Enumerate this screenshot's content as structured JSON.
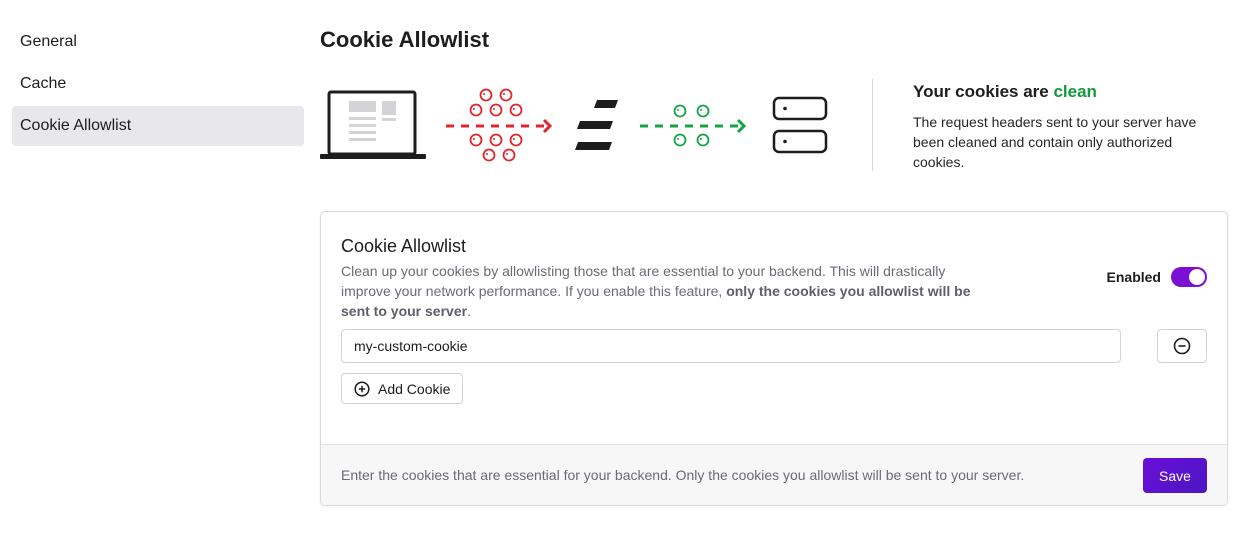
{
  "sidebar": {
    "items": [
      {
        "label": "General",
        "active": false
      },
      {
        "label": "Cache",
        "active": false
      },
      {
        "label": "Cookie Allowlist",
        "active": true
      }
    ]
  },
  "page": {
    "title": "Cookie Allowlist"
  },
  "status": {
    "title_prefix": "Your cookies are ",
    "title_highlight": "clean",
    "description": "The request headers sent to your server have been cleaned and contain only authorized cookies."
  },
  "card": {
    "title": "Cookie Allowlist",
    "description_plain": "Clean up your cookies by allowlisting those that are essential to your backend. This will drastically improve your network performance. If you enable this feature, ",
    "description_bold": "only the cookies you allowlist will be sent to your server",
    "description_end": ".",
    "enabled_label": "Enabled",
    "enabled": true,
    "cookie_value": "my-custom-cookie",
    "add_label": "Add Cookie",
    "footer_text": "Enter the cookies that are essential for your backend. Only the cookies you allowlist will be sent to your server.",
    "save_label": "Save"
  },
  "colors": {
    "accent": "#6a0fd9",
    "clean_green": "#109b3c",
    "cookie_red": "#e0262c",
    "cookie_green": "#15a346"
  },
  "icons": {
    "illustration": [
      "laptop-icon",
      "red-cookies-icon",
      "edge-logo-icon",
      "green-cookies-icon",
      "server-icon"
    ],
    "remove": "minus-circle-icon",
    "add": "plus-circle-icon"
  }
}
